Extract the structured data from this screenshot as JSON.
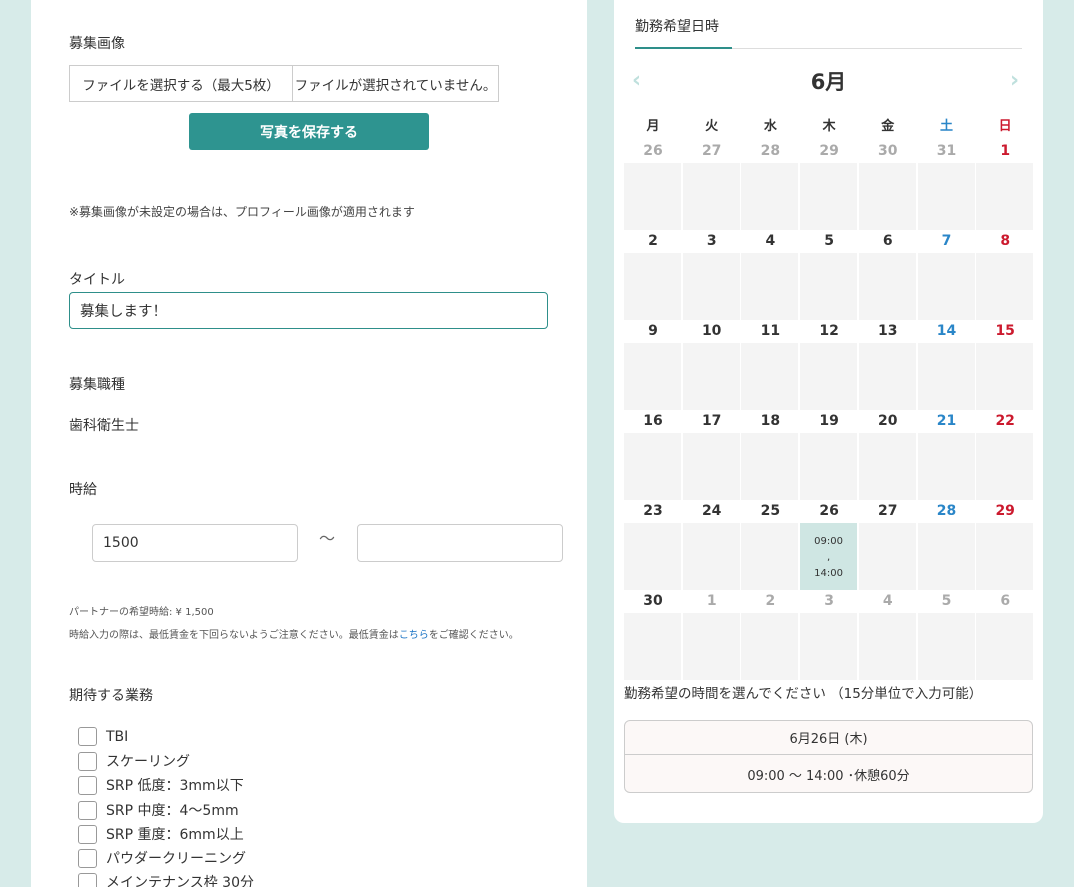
{
  "form": {
    "image_label": "募集画像",
    "file_button": "ファイルを選択する（最大5枚）",
    "file_status": "ファイルが選択されていません。",
    "save_button": "写真を保存する",
    "image_note": "※募集画像が未設定の場合は、プロフィール画像が適用されます",
    "title_label": "タイトル",
    "title_value": "募集します！",
    "job_label": "募集職種",
    "job_value": "歯科衛生士",
    "wage_label": "時給",
    "wage_min": "1500",
    "wage_max": "",
    "wage_tilde": "〜",
    "partner_wage": "パートナーの希望時給: ¥ 1,500",
    "min_wage_note": "時給入力の際は、最低賃金を下回らないようご注意ください。最低賃金は",
    "min_wage_link": "こちら",
    "min_wage_note_end": "をご確認ください。",
    "tasks_label": "期待する業務",
    "tasks": [
      {
        "label": "TBI",
        "checked": false
      },
      {
        "label": "スケーリング",
        "checked": false
      },
      {
        "label": "SRP 低度：3mm以下",
        "checked": false
      },
      {
        "label": "SRP 中度：4〜5mm",
        "checked": false
      },
      {
        "label": "SRP 重度：6mm以上",
        "checked": false
      },
      {
        "label": "パウダークリーニング",
        "checked": false
      },
      {
        "label": "メインテナンス枠 30分",
        "checked": false
      }
    ]
  },
  "calendar": {
    "tab_label": "勤務希望日時",
    "month": "6月",
    "prev_arrow": "‹",
    "next_arrow": "›",
    "weekdays": [
      "月",
      "火",
      "水",
      "木",
      "金",
      "土",
      "日"
    ],
    "weeks": [
      [
        "26",
        "27",
        "28",
        "29",
        "30",
        "31",
        "1"
      ],
      [
        "2",
        "3",
        "4",
        "5",
        "6",
        "7",
        "8"
      ],
      [
        "9",
        "10",
        "11",
        "12",
        "13",
        "14",
        "15"
      ],
      [
        "16",
        "17",
        "18",
        "19",
        "20",
        "21",
        "22"
      ],
      [
        "23",
        "24",
        "25",
        "26",
        "27",
        "28",
        "29"
      ],
      [
        "30",
        "1",
        "2",
        "3",
        "4",
        "5",
        "6"
      ]
    ],
    "selected": {
      "week": 4,
      "day": 3,
      "start": "09:00",
      "sep": ",",
      "end": "14:00"
    },
    "colors": {
      "weekday": "#333333",
      "saturday": "#2a86c8",
      "sunday": "#cc1a2e",
      "other_month": "#aaaaaa"
    },
    "hint": "勤務希望の時間を選んでください （15分単位で入力可能）",
    "summary_date": "6月26日 (木)",
    "summary_time": "09:00 〜 14:00 ･休憩60分"
  }
}
